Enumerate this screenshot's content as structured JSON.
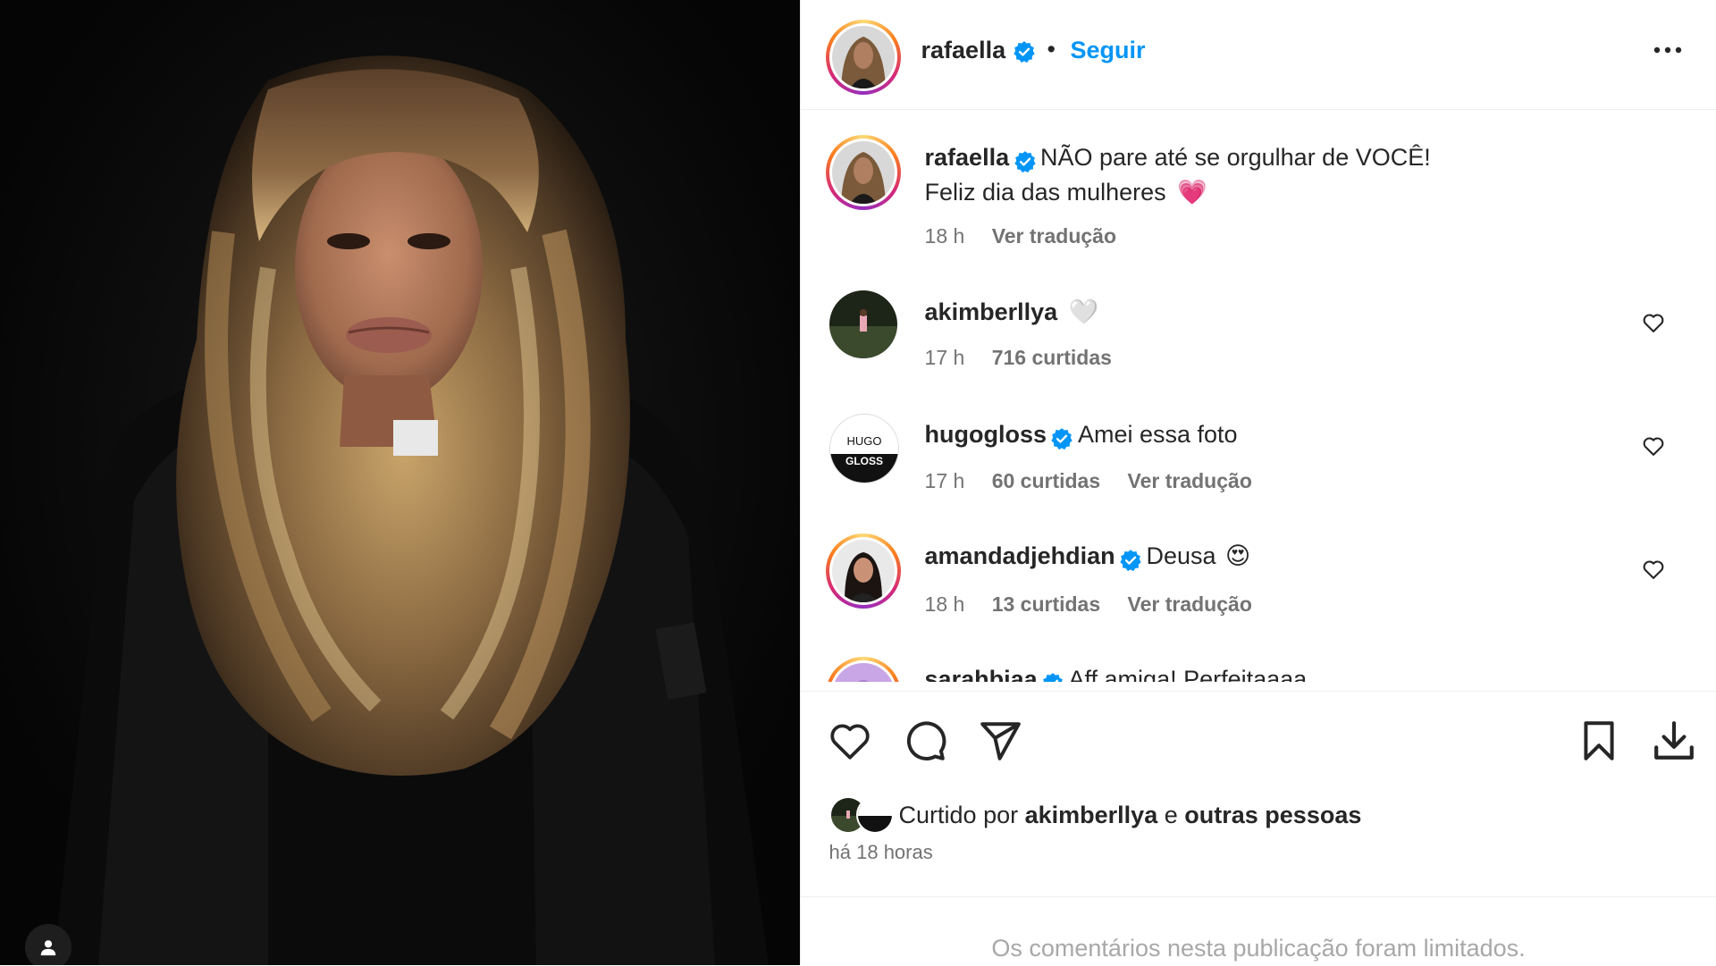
{
  "post": {
    "author": "rafaella",
    "follow_label": "Seguir",
    "separator": "•",
    "more_icon": "more-horizontal-icon"
  },
  "caption": {
    "username": "rafaella",
    "line1": "NÃO pare até se orgulhar de VOCÊ!",
    "line2": "Feliz dia das mulheres",
    "emoji": "💗",
    "time": "18 h",
    "translate": "Ver tradução"
  },
  "comments": [
    {
      "username": "akimberllya",
      "text": "🤍",
      "time": "17 h",
      "likes": "716 curtidas",
      "translate": ""
    },
    {
      "username": "hugogloss",
      "text": "Amei essa foto",
      "time": "17 h",
      "likes": "60 curtidas",
      "translate": "Ver tradução",
      "avatar_text": [
        "HUGO",
        "GLOSS"
      ]
    },
    {
      "username": "amandadjehdian",
      "text": "Deusa",
      "emoji": "😍",
      "time": "18 h",
      "likes": "13 curtidas",
      "translate": "Ver tradução"
    },
    {
      "username": "sarahbiaa",
      "text": "Aff amiga! Perfeitaaaa"
    }
  ],
  "liked_by": {
    "prefix": "Curtido por",
    "user": "akimberllya",
    "joiner": "e",
    "others": "outras pessoas"
  },
  "time_ago": "há 18 horas",
  "footer_notice": "Os comentários nesta publicação foram limitados.",
  "colors": {
    "link": "#0095f6",
    "secondary": "#737373",
    "muted": "#a8a8a8",
    "verified": "#0095f6"
  }
}
